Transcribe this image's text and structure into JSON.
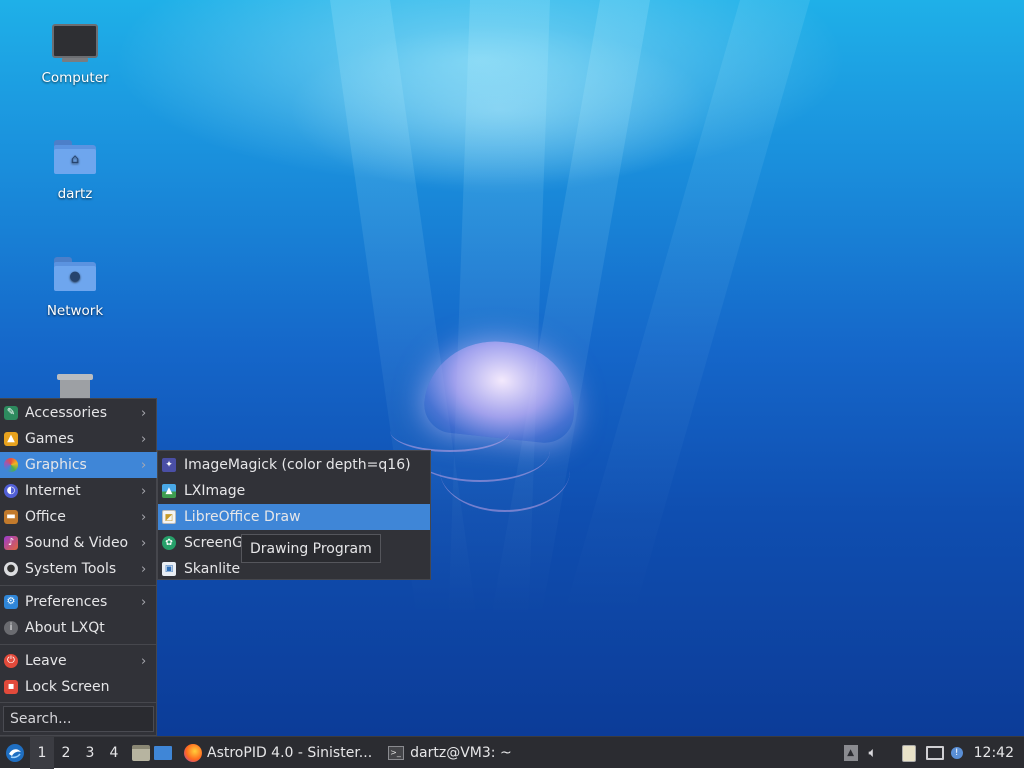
{
  "desktop": {
    "icons": [
      {
        "label": "Computer",
        "icon": "computer-icon"
      },
      {
        "label": "dartz",
        "icon": "home-folder-icon"
      },
      {
        "label": "Network",
        "icon": "network-folder-icon"
      },
      {
        "label": "",
        "icon": "trash-icon"
      }
    ]
  },
  "menu": {
    "items": [
      {
        "label": "Accessories",
        "icon": "accessories-icon"
      },
      {
        "label": "Games",
        "icon": "games-icon"
      },
      {
        "label": "Graphics",
        "icon": "graphics-icon"
      },
      {
        "label": "Internet",
        "icon": "internet-icon"
      },
      {
        "label": "Office",
        "icon": "office-icon"
      },
      {
        "label": "Sound & Video",
        "icon": "sound-video-icon"
      },
      {
        "label": "System Tools",
        "icon": "system-tools-icon"
      },
      {
        "label": "Preferences",
        "icon": "preferences-icon"
      },
      {
        "label": "About LXQt",
        "icon": "info-icon"
      },
      {
        "label": "Leave",
        "icon": "power-icon"
      },
      {
        "label": "Lock Screen",
        "icon": "lock-icon"
      }
    ],
    "search_placeholder": "Search..."
  },
  "submenu": {
    "items": [
      {
        "label": "ImageMagick (color depth=q16)",
        "icon": "imagemagick-icon"
      },
      {
        "label": "LXImage",
        "icon": "lximage-icon"
      },
      {
        "label": "LibreOffice Draw",
        "icon": "libreoffice-draw-icon"
      },
      {
        "label": "ScreenGrab",
        "visible_label": "ScreenG",
        "icon": "screengrab-icon"
      },
      {
        "label": "Skanlite",
        "icon": "skanlite-icon"
      }
    ]
  },
  "tooltip": {
    "text": "Drawing Program"
  },
  "taskbar": {
    "desktops": [
      "1",
      "2",
      "3",
      "4"
    ],
    "tasks": [
      {
        "label": "AstroPID 4.0 - Sinister...",
        "icon": "firefox-icon"
      },
      {
        "label": "dartz@VM3: ~",
        "icon": "terminal-icon"
      }
    ],
    "clock": "12:42"
  },
  "colors": {
    "highlight": "#3f86d7",
    "menu_bg": "#313238",
    "taskbar_bg": "#2b2c31"
  }
}
